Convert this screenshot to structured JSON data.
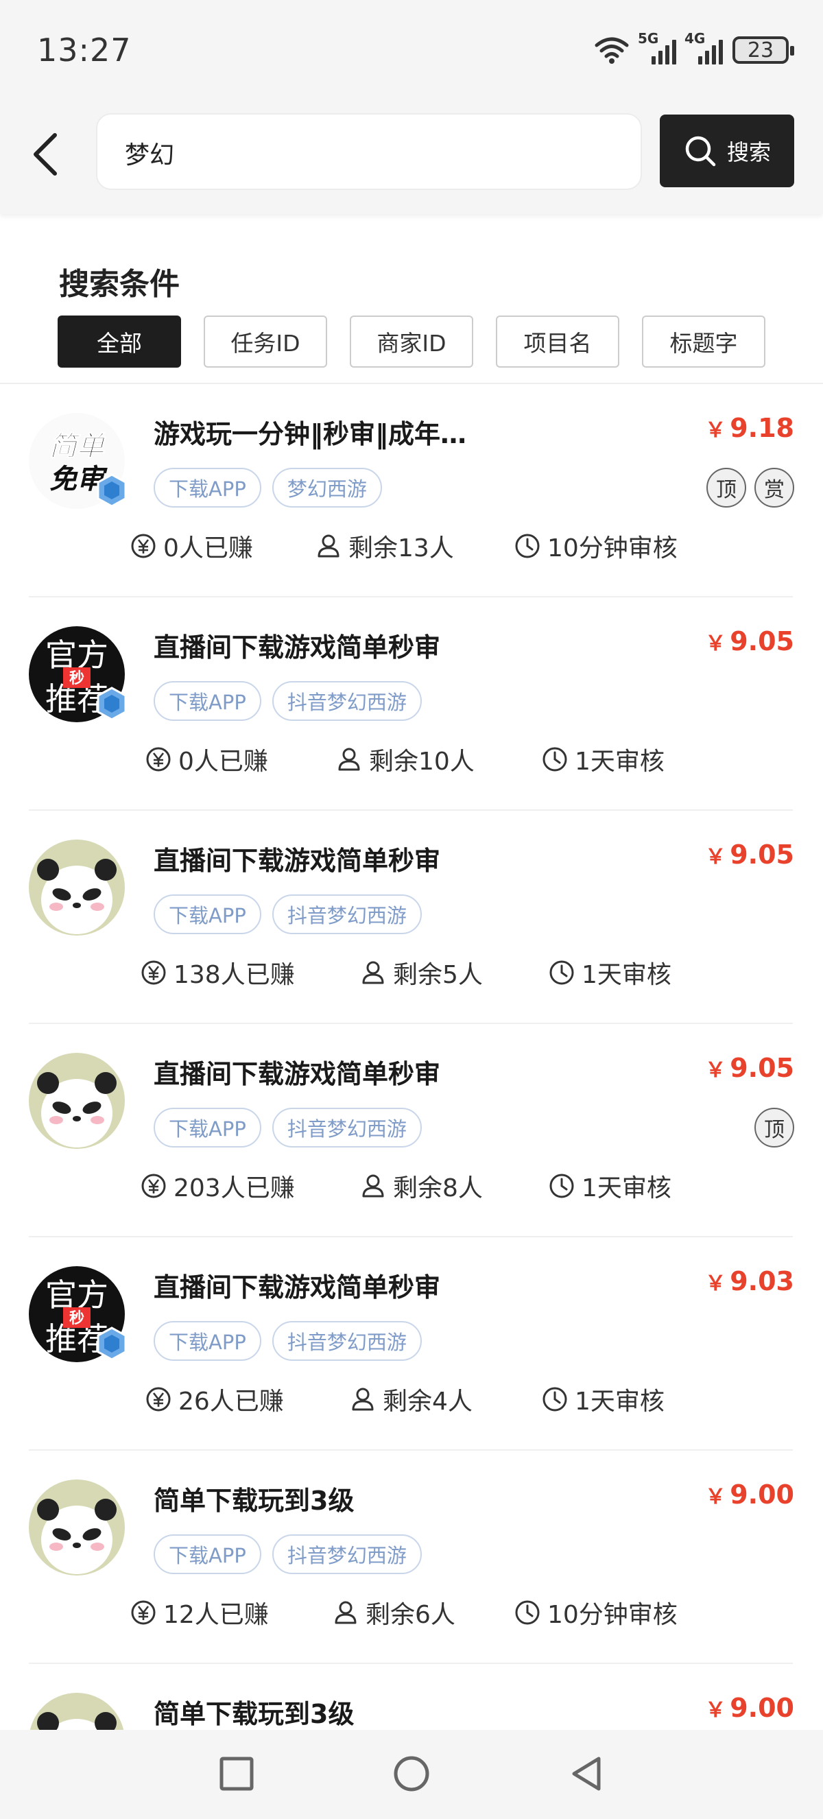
{
  "status_bar": {
    "time": "13:27",
    "signal1_label": "5G",
    "signal2_label": "4G",
    "battery": "23"
  },
  "search": {
    "query": "梦幻",
    "button_label": "搜索"
  },
  "conditions": {
    "title": "搜索条件",
    "filters": [
      "全部",
      "任务ID",
      "商家ID",
      "项目名",
      "标题字"
    ],
    "active_filter": "全部"
  },
  "colors": {
    "price": "#e8412c",
    "tag_text": "#7f9cc8",
    "tag_border": "#c9d6ea",
    "active_filter_bg": "#1e1e1e"
  },
  "currency_symbol": "￥",
  "tasks": [
    {
      "title": "游戏玩一分钟‖秒审‖成年…",
      "price": "9.18",
      "tags": [
        "下载APP",
        "梦幻西游"
      ],
      "badges": [
        "顶",
        "赏"
      ],
      "earned": "0人已赚",
      "remaining": "剩余13人",
      "review": "10分钟审核",
      "avatar": "easy-review-logo",
      "avatar_text_1": "简单",
      "avatar_text_2": "免审",
      "verified": true
    },
    {
      "title": "直播间下载游戏简单秒审",
      "price": "9.05",
      "tags": [
        "下载APP",
        "抖音梦幻西游"
      ],
      "badges": [],
      "earned": "0人已赚",
      "remaining": "剩余10人",
      "review": "1天审核",
      "avatar": "official-recommend-logo",
      "avatar_text_1": "官方",
      "avatar_text_2": "推荐",
      "avatar_text_3": "秒",
      "verified": true
    },
    {
      "title": "直播间下载游戏简单秒审",
      "price": "9.05",
      "tags": [
        "下载APP",
        "抖音梦幻西游"
      ],
      "badges": [],
      "earned": "138人已赚",
      "remaining": "剩余5人",
      "review": "1天审核",
      "avatar": "panda-avatar",
      "verified": false
    },
    {
      "title": "直播间下载游戏简单秒审",
      "price": "9.05",
      "tags": [
        "下载APP",
        "抖音梦幻西游"
      ],
      "badges": [
        "顶"
      ],
      "earned": "203人已赚",
      "remaining": "剩余8人",
      "review": "1天审核",
      "avatar": "panda-avatar",
      "verified": false
    },
    {
      "title": "直播间下载游戏简单秒审",
      "price": "9.03",
      "tags": [
        "下载APP",
        "抖音梦幻西游"
      ],
      "badges": [],
      "earned": "26人已赚",
      "remaining": "剩余4人",
      "review": "1天审核",
      "avatar": "official-recommend-logo",
      "avatar_text_1": "官方",
      "avatar_text_2": "推荐",
      "avatar_text_3": "秒",
      "verified": true
    },
    {
      "title": "简单下载玩到3级",
      "price": "9.00",
      "tags": [
        "下载APP",
        "抖音梦幻西游"
      ],
      "badges": [],
      "earned": "12人已赚",
      "remaining": "剩余6人",
      "review": "10分钟审核",
      "avatar": "panda-avatar",
      "verified": false
    },
    {
      "title": "简单下载玩到3级",
      "price": "9.00",
      "tags": [],
      "badges": [],
      "earned": "",
      "remaining": "",
      "review": "",
      "avatar": "panda-avatar",
      "verified": false
    }
  ]
}
